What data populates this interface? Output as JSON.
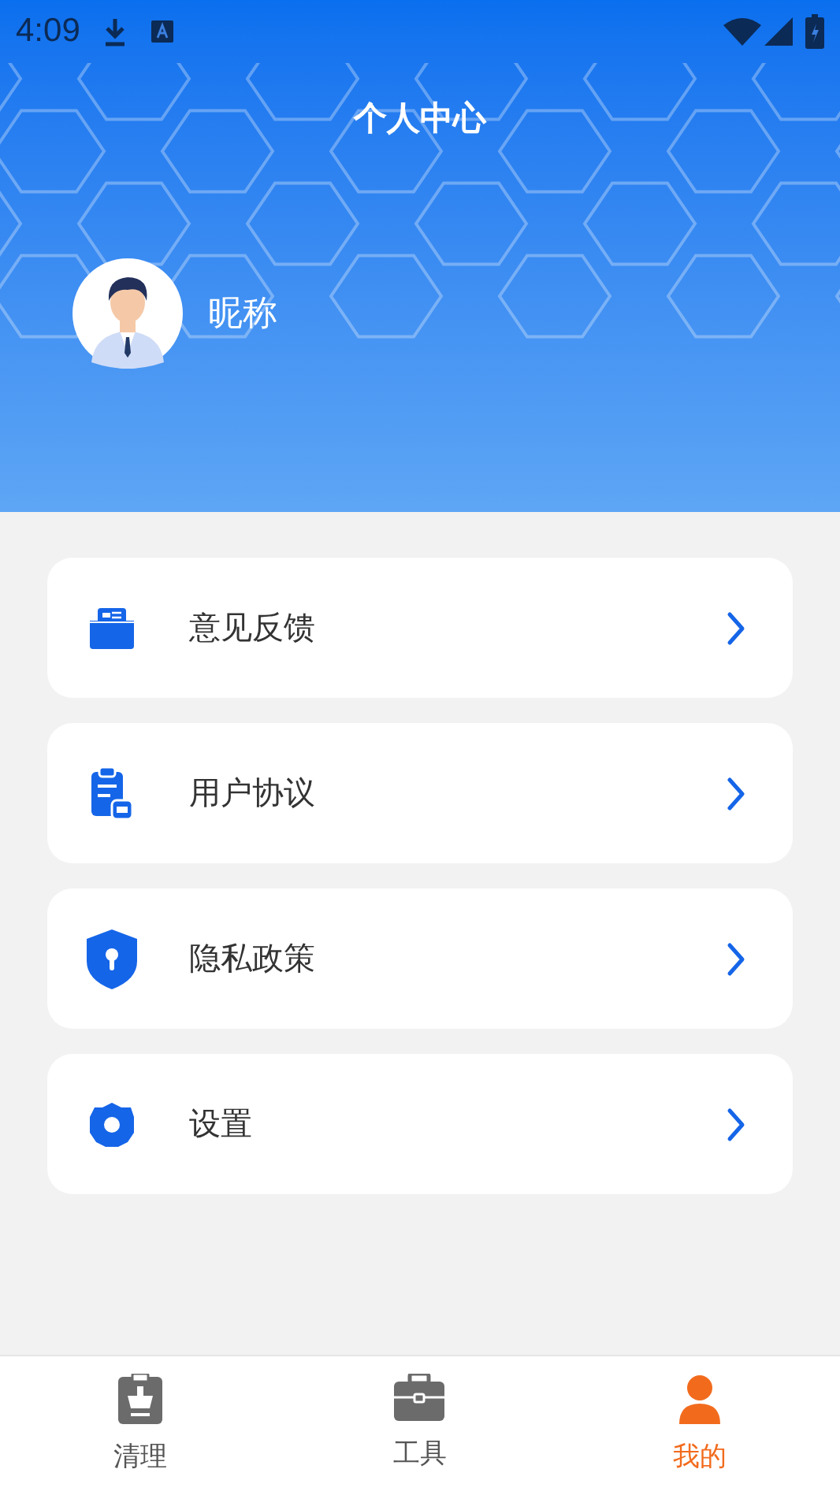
{
  "status_bar": {
    "time": "4:09"
  },
  "header": {
    "title": "个人中心",
    "nickname": "昵称"
  },
  "menu": [
    {
      "label": "意见反馈"
    },
    {
      "label": "用户协议"
    },
    {
      "label": "隐私政策"
    },
    {
      "label": "设置"
    }
  ],
  "bottom_nav": [
    {
      "label": "清理",
      "selected": false
    },
    {
      "label": "工具",
      "selected": false
    },
    {
      "label": "我的",
      "selected": true
    }
  ]
}
